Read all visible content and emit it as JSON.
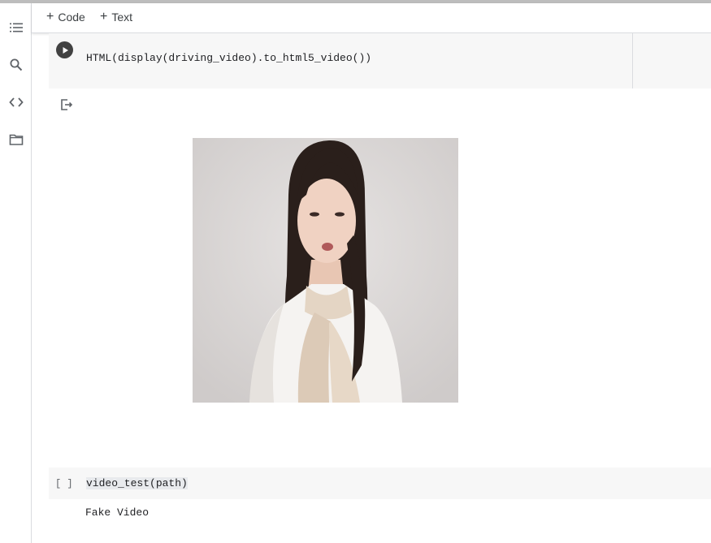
{
  "toolbar": {
    "add_code_label": "Code",
    "add_text_label": "Text"
  },
  "sidebar": {
    "items": [
      {
        "icon": "table-of-contents-icon"
      },
      {
        "icon": "search-icon"
      },
      {
        "icon": "code-snippets-icon"
      },
      {
        "icon": "folder-icon"
      }
    ]
  },
  "cells": {
    "display_cell": {
      "code": "HTML(display(driving_video).to_html5_video())"
    },
    "test_cell": {
      "exec_count": "[ ]",
      "code": "video_test(path)",
      "output": "Fake Video"
    }
  },
  "colors": {
    "cell_background": "#f7f7f7",
    "run_button": "#424242",
    "divider": "#dadce0"
  }
}
